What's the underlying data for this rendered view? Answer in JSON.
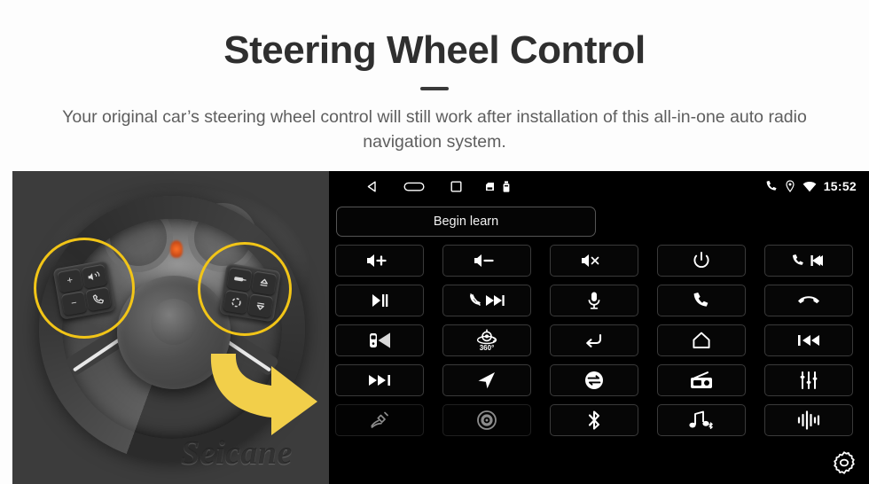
{
  "header": {
    "title": "Steering Wheel Control",
    "subtitle": "Your original car’s steering wheel control will still work after installation of this all-in-one auto radio navigation system."
  },
  "photo": {
    "watermark": "Seicane",
    "highlight_color": "#F2C517",
    "arrow_color": "#F2CF4A",
    "highlights": [
      {
        "name": "left-steering-wheel-controls"
      },
      {
        "name": "right-steering-wheel-controls"
      }
    ]
  },
  "headunit": {
    "statusbar": {
      "nav_icons": [
        "back-icon",
        "home-icon",
        "recents-icon"
      ],
      "system_icons": [
        "sd-card-icon",
        "usb-icon"
      ],
      "right_icons": [
        "phone-icon",
        "location-pin-icon",
        "wifi-icon"
      ],
      "time": "15:52"
    },
    "learn_button": {
      "label": "Begin learn"
    },
    "settings_button": {
      "icon": "gear-icon"
    },
    "grid": {
      "rows": 5,
      "columns": 5,
      "buttons": [
        {
          "name": "volume-up-button",
          "icon": "volume-up-icon"
        },
        {
          "name": "volume-down-button",
          "icon": "volume-down-icon"
        },
        {
          "name": "mute-button",
          "icon": "volume-mute-icon"
        },
        {
          "name": "power-button",
          "icon": "power-icon"
        },
        {
          "name": "call-previous-button",
          "icon": "phone-previous-icon"
        },
        {
          "name": "play-pause-button",
          "icon": "play-pause-icon"
        },
        {
          "name": "hangup-next-button",
          "icon": "hangup-next-icon"
        },
        {
          "name": "microphone-button",
          "icon": "microphone-icon"
        },
        {
          "name": "answer-call-button",
          "icon": "phone-icon"
        },
        {
          "name": "end-call-button",
          "icon": "hangup-icon"
        },
        {
          "name": "rear-camera-button",
          "icon": "rear-camera-icon"
        },
        {
          "name": "surround-view-button",
          "icon": "camera-360-icon",
          "label": "360°"
        },
        {
          "name": "back-button",
          "icon": "back-arrow-icon"
        },
        {
          "name": "home-button",
          "icon": "home-outline-icon"
        },
        {
          "name": "previous-track-button",
          "icon": "previous-track-icon"
        },
        {
          "name": "next-track-button",
          "icon": "next-track-icon"
        },
        {
          "name": "navigation-button",
          "icon": "navigation-arrow-icon"
        },
        {
          "name": "source-mode-button",
          "icon": "source-switch-icon"
        },
        {
          "name": "radio-button",
          "icon": "radio-icon"
        },
        {
          "name": "equalizer-button",
          "icon": "equalizer-icon"
        },
        {
          "name": "aux-button",
          "icon": "aux-plug-icon"
        },
        {
          "name": "disc-button",
          "icon": "disc-icon"
        },
        {
          "name": "bluetooth-button",
          "icon": "bluetooth-icon"
        },
        {
          "name": "bluetooth-music-button",
          "icon": "bluetooth-music-icon"
        },
        {
          "name": "voice-assistant-button",
          "icon": "voice-wave-icon"
        }
      ]
    }
  }
}
